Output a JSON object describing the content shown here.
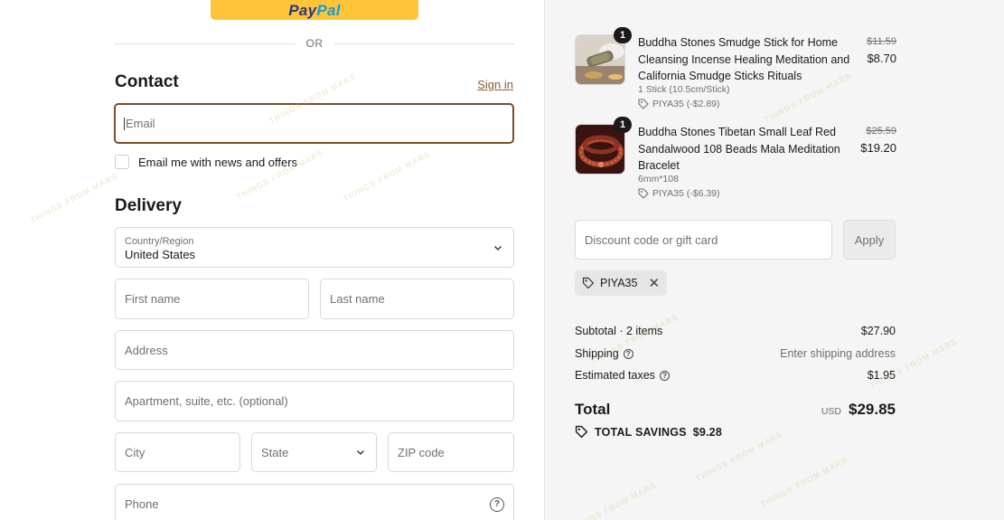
{
  "checkout": {
    "paypal": {
      "pay": "Pay",
      "pal": "Pal"
    },
    "or_text": "OR",
    "contact": {
      "title": "Contact",
      "sign_in": "Sign in",
      "email_placeholder": "Email",
      "newsletter_label": "Email me with news and offers"
    },
    "delivery": {
      "title": "Delivery",
      "country_label": "Country/Region",
      "country_value": "United States",
      "first_name": "First name",
      "last_name": "Last name",
      "address": "Address",
      "apartment": "Apartment, suite, etc. (optional)",
      "city": "City",
      "state": "State",
      "zip": "ZIP code",
      "phone": "Phone"
    }
  },
  "order": {
    "items": [
      {
        "quantity": "1",
        "title": "Buddha Stones Smudge Stick for Home Cleansing Incense Healing Meditation and California Smudge Sticks Rituals",
        "variant": "1 Stick (10.5cm/Stick)",
        "discount": "PIYA35 (-$2.89)",
        "price_old": "$11.59",
        "price_new": "$8.70"
      },
      {
        "quantity": "1",
        "title": "Buddha Stones Tibetan Small Leaf Red Sandalwood 108 Beads Mala Meditation Bracelet",
        "variant": "6mm*108",
        "discount": "PIYA35 (-$6.39)",
        "price_old": "$25.59",
        "price_new": "$19.20"
      }
    ],
    "discount_placeholder": "Discount code or gift card",
    "apply_label": "Apply",
    "applied_code": "PIYA35",
    "summary": {
      "subtotal_label": "Subtotal · 2 items",
      "subtotal_value": "$27.90",
      "shipping_label": "Shipping",
      "shipping_value": "Enter shipping address",
      "taxes_label": "Estimated taxes",
      "taxes_value": "$1.95",
      "total_label": "Total",
      "currency": "USD",
      "total_value": "$29.85",
      "savings_label": "TOTAL SAVINGS",
      "savings_value": "$9.28"
    }
  },
  "watermark": "THINGS FROM MARS",
  "colors": {
    "accent": "#7a4e2a",
    "paypal_yellow": "#ffc439",
    "summary_bg": "#f5f5f5"
  }
}
